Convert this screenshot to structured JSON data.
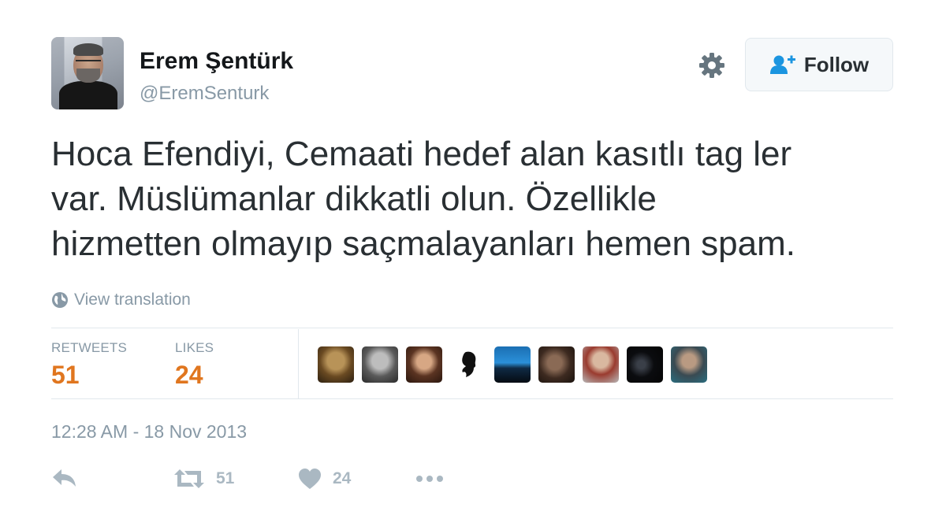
{
  "user": {
    "name": "Erem Şentürk",
    "handle": "@EremSenturk"
  },
  "header": {
    "follow_label": "Follow"
  },
  "tweet": {
    "lines": [
      "Hoca Efendiyi, Cemaati hedef alan kasıtlı tag ler",
      "var. Müslümanlar dikkatli olun. Özellikle",
      "hizmetten olmayıp saçmalayanları hemen spam."
    ],
    "translate_label": "View translation"
  },
  "stats": {
    "retweets_label": "RETWEETS",
    "retweets_value": "51",
    "likes_label": "LIKES",
    "likes_value": "24"
  },
  "timestamp": "12:28 AM - 18 Nov 2013",
  "actions": {
    "retweet_count": "51",
    "like_count": "24"
  },
  "colors": {
    "accent": "#e0761f",
    "muted": "#8899a6",
    "icon": "#aab8c2",
    "follow_icon": "#1b95e0"
  },
  "icons": {
    "settings": "gear-icon",
    "follow": "person-add-icon",
    "translate": "globe-icon",
    "reply": "reply-icon",
    "retweet": "retweet-icon",
    "like": "heart-icon",
    "more": "more-icon"
  }
}
